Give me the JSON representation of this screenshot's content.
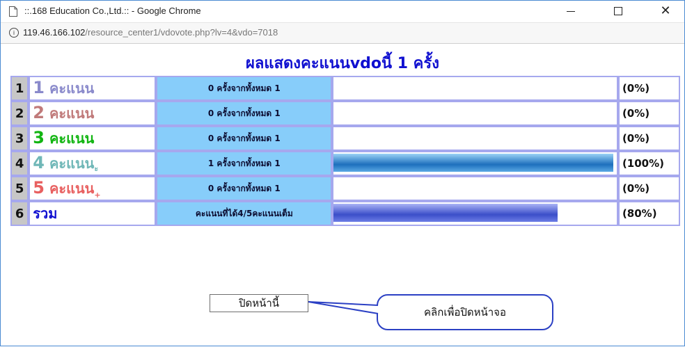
{
  "window": {
    "title": "::.168 Education Co.,Ltd.:: - Google Chrome",
    "url_host": "119.46.166.102",
    "url_path": "/resource_center1/vdovote.php?lv=4&vdo=7018",
    "info_icon": "i"
  },
  "heading": "ผลแสดงคะแนนvdoนี้ 1 ครั้ง",
  "rows": [
    {
      "num": "1",
      "digit": "1",
      "label": " คะแนน",
      "mark": "",
      "color": "#8a8acb",
      "count": "0 ครั้งจากทั้งหมด 1",
      "bar_fraction": 0,
      "pct": "(0%)"
    },
    {
      "num": "2",
      "digit": "2",
      "label": " คะแนน",
      "mark": "",
      "color": "#c07a7a",
      "count": "0 ครั้งจากทั้งหมด 1",
      "bar_fraction": 0,
      "pct": "(0%)"
    },
    {
      "num": "3",
      "digit": "3",
      "label": " คะแนน",
      "mark": "",
      "color": "#12b512",
      "count": "0 ครั้งจากทั้งหมด 1",
      "bar_fraction": 0,
      "pct": "(0%)"
    },
    {
      "num": "4",
      "digit": "4",
      "label": " คะแนน",
      "mark": "ะ",
      "color": "#6fb7b7",
      "count": "1 ครั้งจากทั้งหมด 1",
      "bar_fraction": 1.0,
      "pct": "(100%)"
    },
    {
      "num": "5",
      "digit": "5",
      "label": " คะแนน",
      "mark": "+",
      "color": "#e86060",
      "count": "0 ครั้งจากทั้งหมด 1",
      "bar_fraction": 0,
      "pct": "(0%)"
    }
  ],
  "total": {
    "num": "6",
    "label": "รวม",
    "color": "#1010d0",
    "count": "คะแนนที่ได้4/5คะแนนเต็ม",
    "bar_fraction": 0.8,
    "pct": "(80%)"
  },
  "close_button": "ปิดหน้านี้",
  "callout": "คลิกเพื่อปิดหน้าจอ",
  "colors": {
    "count_bg": "#87cdfa",
    "num_bg": "#c7c7c7",
    "border": "#a6a8ee",
    "callout_border": "#2b40c4"
  }
}
